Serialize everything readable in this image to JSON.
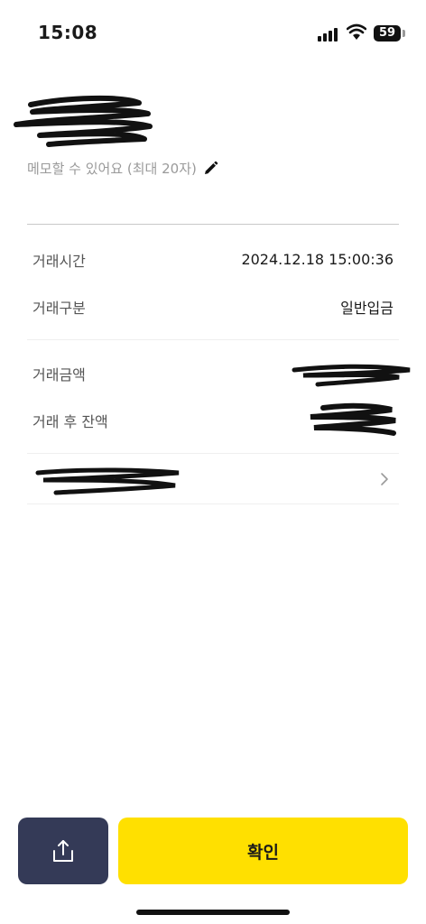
{
  "status_bar": {
    "time": "15:08",
    "battery": "59",
    "icons": [
      "signal-icon",
      "wifi-icon",
      "battery-icon"
    ]
  },
  "header": {
    "memo_placeholder": "메모할 수 있어요 (최대 20자)",
    "memo_icon": "pencil-icon"
  },
  "details": {
    "rows": [
      {
        "label": "거래시간",
        "value": "2024.12.18 15:00:36"
      },
      {
        "label": "거래구분",
        "value": "일반입금"
      },
      {
        "label": "거래금액",
        "value": ""
      },
      {
        "label": "거래 후 잔액",
        "value": ""
      }
    ]
  },
  "link_row": {
    "icon": "chevron-right-icon"
  },
  "actions": {
    "share_icon": "share-icon",
    "confirm_label": "확인"
  },
  "colors": {
    "accent_yellow": "#ffe000",
    "share_button": "#343a57",
    "muted_text": "#9a9a9a"
  }
}
